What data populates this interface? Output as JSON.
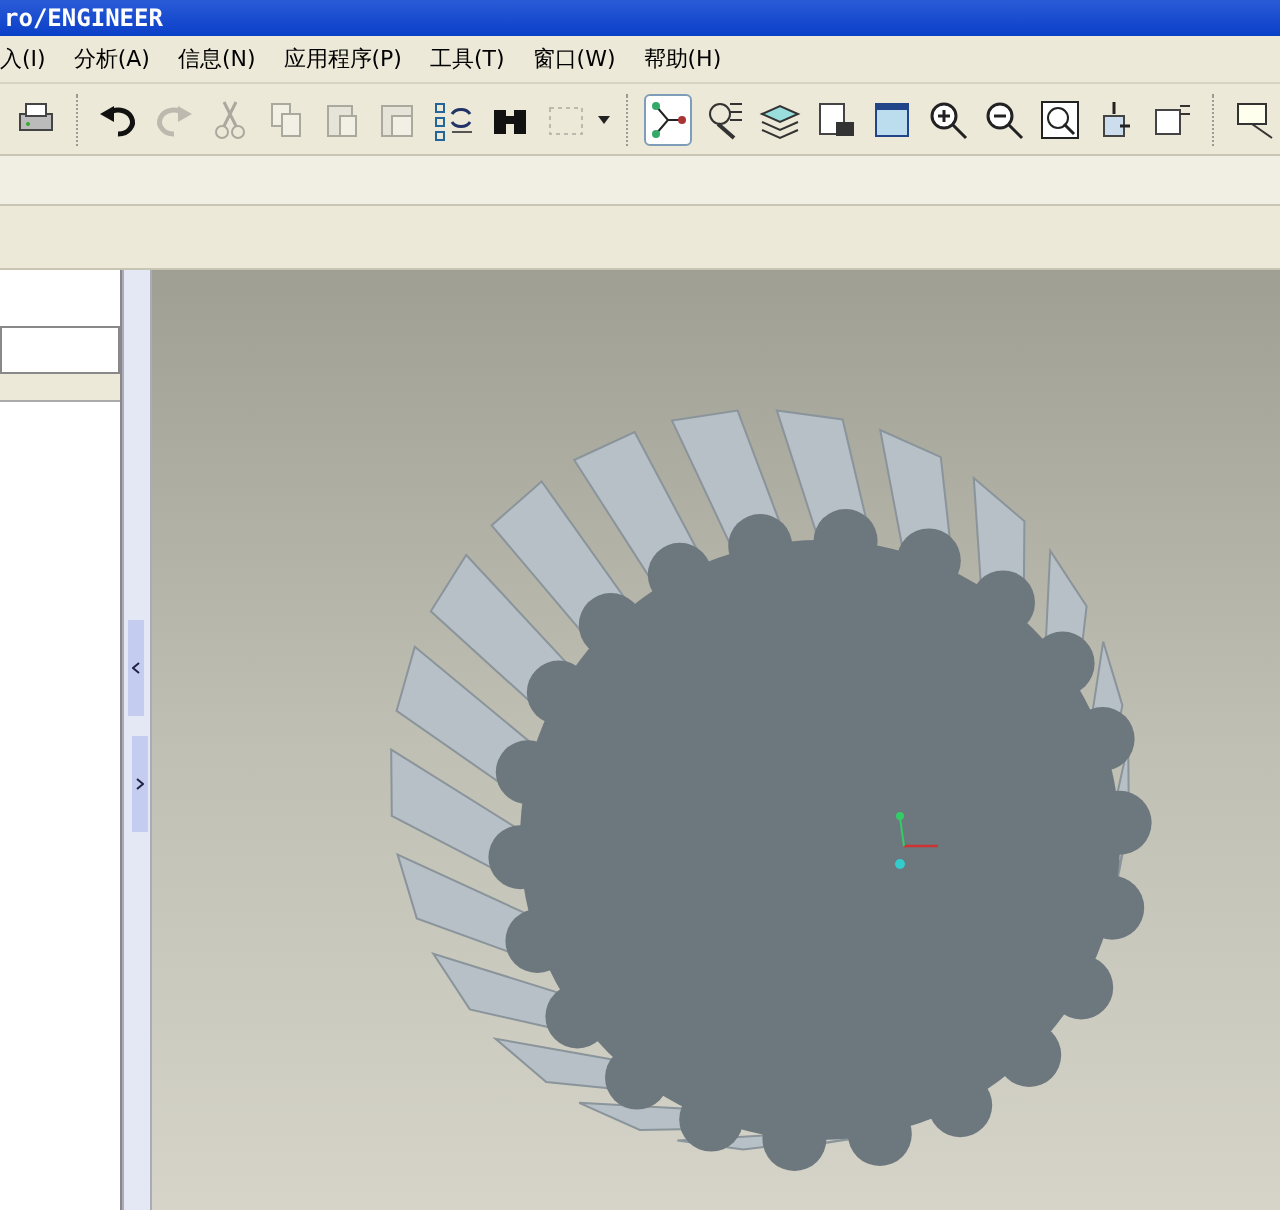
{
  "window": {
    "title": "ro/ENGINEER"
  },
  "menu": [
    {
      "label": "入(I)"
    },
    {
      "label": "分析(A)"
    },
    {
      "label": "信息(N)"
    },
    {
      "label": "应用程序(P)"
    },
    {
      "label": "工具(T)"
    },
    {
      "label": "窗口(W)"
    },
    {
      "label": "帮助(H)"
    }
  ],
  "toolbar": [
    {
      "disabled": false,
      "pressed": false
    },
    {
      "disabled": false,
      "pressed": false
    },
    {
      "disabled": true,
      "pressed": false
    },
    {
      "disabled": true,
      "pressed": false
    },
    {
      "disabled": true,
      "pressed": false
    },
    {
      "disabled": true,
      "pressed": false
    },
    {
      "disabled": true,
      "pressed": false
    },
    {
      "disabled": false,
      "pressed": false
    },
    {
      "disabled": false,
      "pressed": false
    },
    {
      "disabled": true,
      "pressed": false
    },
    {
      "disabled": false,
      "pressed": true
    },
    {
      "disabled": false,
      "pressed": false
    },
    {
      "disabled": false,
      "pressed": false
    },
    {
      "disabled": false,
      "pressed": false
    },
    {
      "disabled": false,
      "pressed": false
    },
    {
      "disabled": false,
      "pressed": false
    },
    {
      "disabled": false,
      "pressed": false
    },
    {
      "disabled": false,
      "pressed": false
    },
    {
      "disabled": false,
      "pressed": false
    },
    {
      "disabled": false,
      "pressed": false
    },
    {
      "disabled": false,
      "pressed": false
    }
  ]
}
